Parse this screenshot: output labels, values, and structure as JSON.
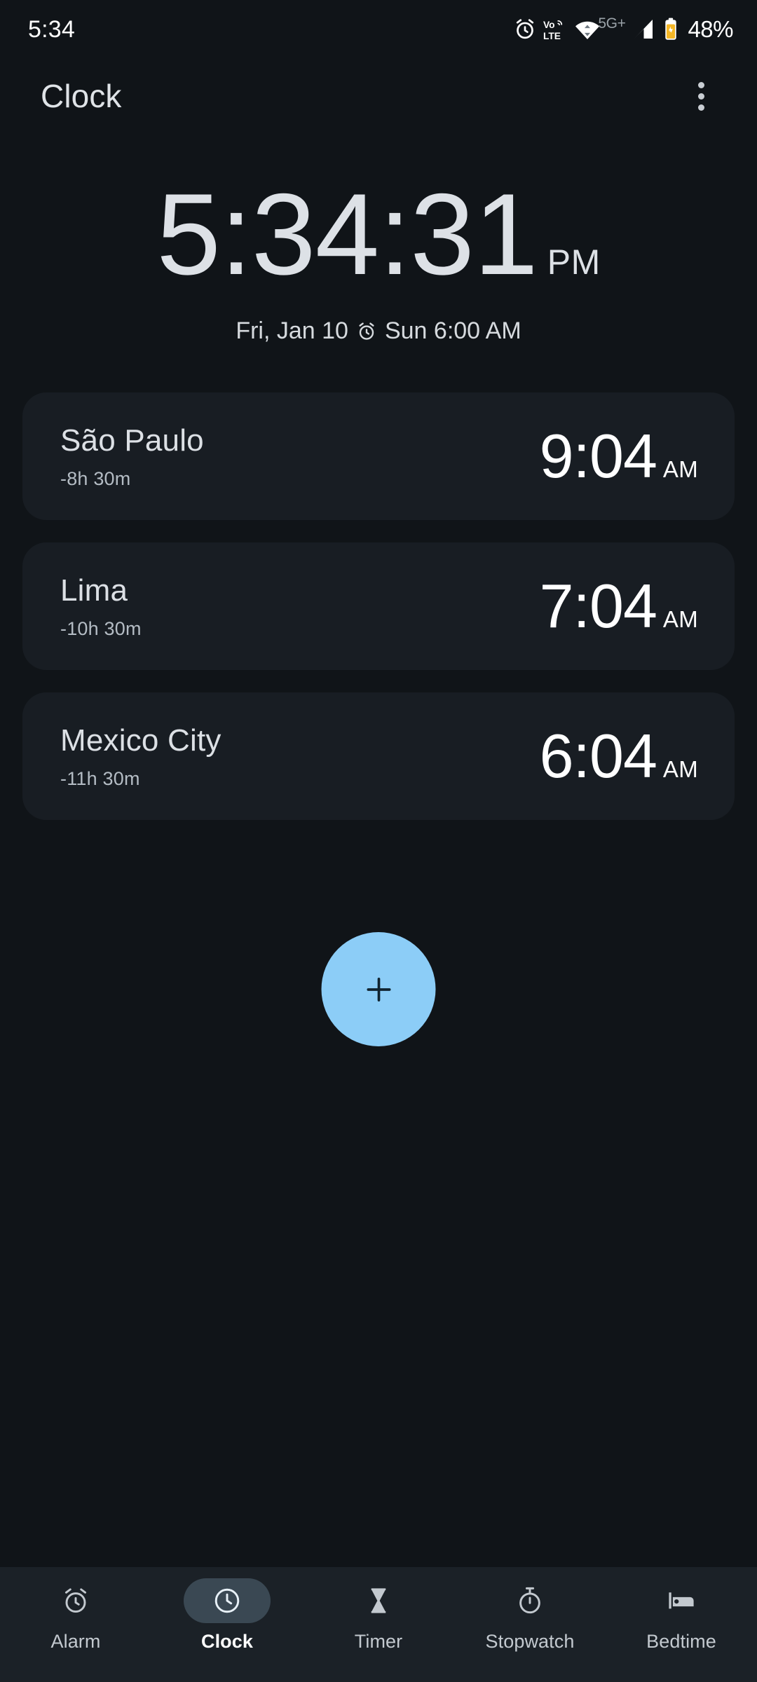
{
  "status_bar": {
    "time": "5:34",
    "network_label": "5G+",
    "battery_percent": "48%",
    "icons": [
      "alarm-icon",
      "volte-icon",
      "wifi-icon",
      "signal-icon",
      "battery-charging-icon"
    ]
  },
  "app_bar": {
    "title": "Clock",
    "overflow_label": "More options"
  },
  "clock": {
    "time": "5:34:31",
    "ampm": "PM",
    "date": "Fri, Jan 10",
    "alarm_icon": "alarm-icon",
    "next_alarm": "Sun 6:00 AM"
  },
  "world_clocks": [
    {
      "city": "São Paulo",
      "offset": "-8h 30m",
      "time": "9:04",
      "ampm": "AM"
    },
    {
      "city": "Lima",
      "offset": "-10h 30m",
      "time": "7:04",
      "ampm": "AM"
    },
    {
      "city": "Mexico City",
      "offset": "-11h 30m",
      "time": "6:04",
      "ampm": "AM"
    }
  ],
  "fab": {
    "icon": "plus-icon",
    "label": "Add city"
  },
  "bottom_nav": {
    "active_index": 1,
    "items": [
      {
        "label": "Alarm",
        "icon": "alarm-icon"
      },
      {
        "label": "Clock",
        "icon": "clock-icon"
      },
      {
        "label": "Timer",
        "icon": "hourglass-icon"
      },
      {
        "label": "Stopwatch",
        "icon": "stopwatch-icon"
      },
      {
        "label": "Bedtime",
        "icon": "bed-icon"
      }
    ]
  },
  "colors": {
    "background": "#101418",
    "card": "#181d23",
    "nav_background": "#1b2127",
    "fab": "#8ccdf7",
    "accent_pill": "#3a4853",
    "battery": "#f5b726",
    "primary_text": "#dde1e6",
    "secondary_text": "#b4bcc4"
  }
}
